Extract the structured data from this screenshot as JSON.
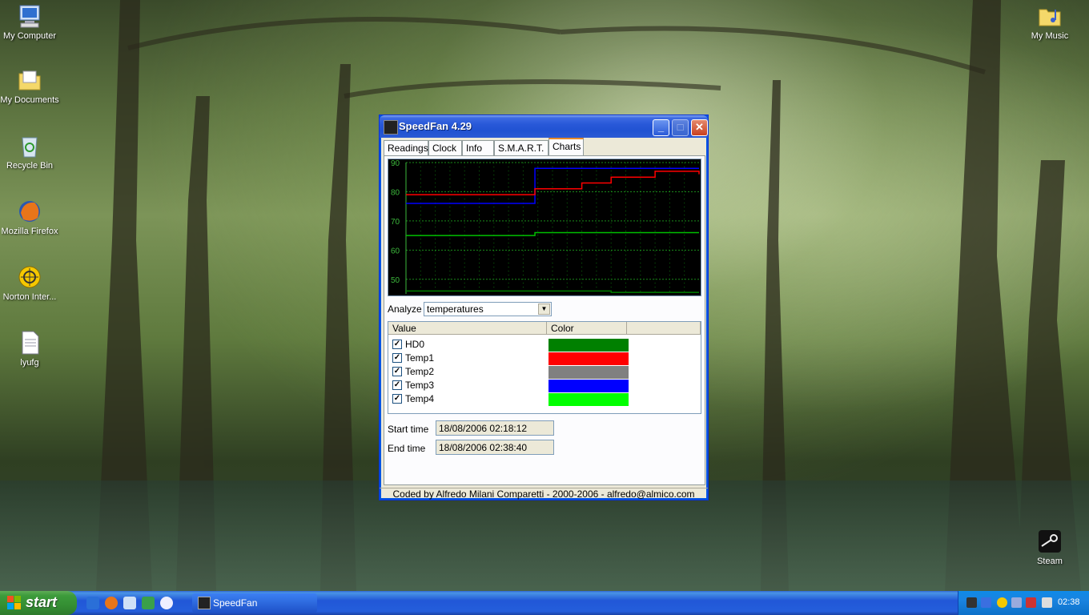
{
  "desktop": {
    "icons_left": [
      {
        "label": "My Computer",
        "icon": "computer-icon"
      },
      {
        "label": "My Documents",
        "icon": "folder-icon"
      },
      {
        "label": "Recycle Bin",
        "icon": "recycle-bin-icon"
      },
      {
        "label": "Mozilla Firefox",
        "icon": "firefox-icon"
      },
      {
        "label": "Norton Inter...",
        "icon": "norton-icon"
      },
      {
        "label": "lyufg",
        "icon": "text-file-icon"
      }
    ],
    "icons_right": [
      {
        "label": "My Music",
        "icon": "music-folder-icon"
      },
      {
        "label": "Steam",
        "icon": "steam-icon"
      }
    ]
  },
  "window": {
    "title": "SpeedFan 4.29",
    "tabs": [
      "Readings",
      "Clock",
      "Info",
      "S.M.A.R.T.",
      "Charts"
    ],
    "active_tab": "Charts",
    "analyze_label": "Analyze",
    "analyze_value": "temperatures",
    "list_headers": [
      "Value",
      "Color"
    ],
    "sensors": [
      {
        "name": "HD0",
        "checked": true,
        "color": "#008000"
      },
      {
        "name": "Temp1",
        "checked": true,
        "color": "#ff0000"
      },
      {
        "name": "Temp2",
        "checked": true,
        "color": "#808080"
      },
      {
        "name": "Temp3",
        "checked": true,
        "color": "#0000ff"
      },
      {
        "name": "Temp4",
        "checked": true,
        "color": "#00ff00"
      }
    ],
    "start_label": "Start time",
    "start_value": "18/08/2006 02:18:12",
    "end_label": "End time",
    "end_value": "18/08/2006 02:38:40",
    "status": "Coded by Alfredo Milani Comparetti - 2000-2006 - alfredo@almico.com"
  },
  "chart_data": {
    "type": "line",
    "ylim": [
      45,
      90
    ],
    "yticks": [
      "90",
      "80",
      "70",
      "60",
      "50"
    ],
    "grid": true,
    "x": [
      0,
      0.43,
      0.44,
      0.6,
      0.7,
      0.85,
      1.0
    ],
    "series": [
      {
        "color": "#0000ff",
        "values": [
          76,
          76,
          88,
          88,
          88,
          88,
          88
        ]
      },
      {
        "color": "#ff0000",
        "values": [
          79,
          79,
          81,
          83,
          85,
          87,
          86
        ]
      },
      {
        "color": "#00c000",
        "values": [
          65,
          65,
          66,
          66,
          66,
          66,
          66
        ]
      },
      {
        "color": "#008000",
        "values": [
          46,
          46,
          46,
          46,
          45.5,
          45.5,
          45.5
        ]
      }
    ]
  },
  "taskbar": {
    "start_label": "start",
    "quick_launch": [
      "ie-icon",
      "firefox-icon",
      "explorer-icon",
      "messenger-icon",
      "media-player-icon"
    ],
    "task_label": "SpeedFan",
    "clock": "02:38"
  }
}
